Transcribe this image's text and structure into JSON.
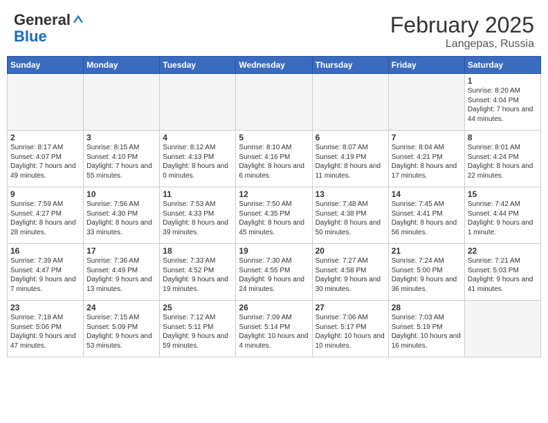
{
  "header": {
    "logo_general": "General",
    "logo_blue": "Blue",
    "month_year": "February 2025",
    "location": "Langepas, Russia"
  },
  "weekdays": [
    "Sunday",
    "Monday",
    "Tuesday",
    "Wednesday",
    "Thursday",
    "Friday",
    "Saturday"
  ],
  "weeks": [
    [
      {
        "day": "",
        "empty": true
      },
      {
        "day": "",
        "empty": true
      },
      {
        "day": "",
        "empty": true
      },
      {
        "day": "",
        "empty": true
      },
      {
        "day": "",
        "empty": true
      },
      {
        "day": "",
        "empty": true
      },
      {
        "day": "1",
        "sunrise": "8:20 AM",
        "sunset": "4:04 PM",
        "daylight": "7 hours and 44 minutes."
      }
    ],
    [
      {
        "day": "2",
        "sunrise": "8:17 AM",
        "sunset": "4:07 PM",
        "daylight": "7 hours and 49 minutes."
      },
      {
        "day": "3",
        "sunrise": "8:15 AM",
        "sunset": "4:10 PM",
        "daylight": "7 hours and 55 minutes."
      },
      {
        "day": "4",
        "sunrise": "8:12 AM",
        "sunset": "4:13 PM",
        "daylight": "8 hours and 0 minutes."
      },
      {
        "day": "5",
        "sunrise": "8:10 AM",
        "sunset": "4:16 PM",
        "daylight": "8 hours and 6 minutes."
      },
      {
        "day": "6",
        "sunrise": "8:07 AM",
        "sunset": "4:19 PM",
        "daylight": "8 hours and 11 minutes."
      },
      {
        "day": "7",
        "sunrise": "8:04 AM",
        "sunset": "4:21 PM",
        "daylight": "8 hours and 17 minutes."
      },
      {
        "day": "8",
        "sunrise": "8:01 AM",
        "sunset": "4:24 PM",
        "daylight": "8 hours and 22 minutes."
      }
    ],
    [
      {
        "day": "9",
        "sunrise": "7:59 AM",
        "sunset": "4:27 PM",
        "daylight": "8 hours and 28 minutes."
      },
      {
        "day": "10",
        "sunrise": "7:56 AM",
        "sunset": "4:30 PM",
        "daylight": "8 hours and 33 minutes."
      },
      {
        "day": "11",
        "sunrise": "7:53 AM",
        "sunset": "4:33 PM",
        "daylight": "8 hours and 39 minutes."
      },
      {
        "day": "12",
        "sunrise": "7:50 AM",
        "sunset": "4:35 PM",
        "daylight": "8 hours and 45 minutes."
      },
      {
        "day": "13",
        "sunrise": "7:48 AM",
        "sunset": "4:38 PM",
        "daylight": "8 hours and 50 minutes."
      },
      {
        "day": "14",
        "sunrise": "7:45 AM",
        "sunset": "4:41 PM",
        "daylight": "8 hours and 56 minutes."
      },
      {
        "day": "15",
        "sunrise": "7:42 AM",
        "sunset": "4:44 PM",
        "daylight": "9 hours and 1 minute."
      }
    ],
    [
      {
        "day": "16",
        "sunrise": "7:39 AM",
        "sunset": "4:47 PM",
        "daylight": "9 hours and 7 minutes."
      },
      {
        "day": "17",
        "sunrise": "7:36 AM",
        "sunset": "4:49 PM",
        "daylight": "9 hours and 13 minutes."
      },
      {
        "day": "18",
        "sunrise": "7:33 AM",
        "sunset": "4:52 PM",
        "daylight": "9 hours and 19 minutes."
      },
      {
        "day": "19",
        "sunrise": "7:30 AM",
        "sunset": "4:55 PM",
        "daylight": "9 hours and 24 minutes."
      },
      {
        "day": "20",
        "sunrise": "7:27 AM",
        "sunset": "4:58 PM",
        "daylight": "9 hours and 30 minutes."
      },
      {
        "day": "21",
        "sunrise": "7:24 AM",
        "sunset": "5:00 PM",
        "daylight": "9 hours and 36 minutes."
      },
      {
        "day": "22",
        "sunrise": "7:21 AM",
        "sunset": "5:03 PM",
        "daylight": "9 hours and 41 minutes."
      }
    ],
    [
      {
        "day": "23",
        "sunrise": "7:18 AM",
        "sunset": "5:06 PM",
        "daylight": "9 hours and 47 minutes."
      },
      {
        "day": "24",
        "sunrise": "7:15 AM",
        "sunset": "5:09 PM",
        "daylight": "9 hours and 53 minutes."
      },
      {
        "day": "25",
        "sunrise": "7:12 AM",
        "sunset": "5:11 PM",
        "daylight": "9 hours and 59 minutes."
      },
      {
        "day": "26",
        "sunrise": "7:09 AM",
        "sunset": "5:14 PM",
        "daylight": "10 hours and 4 minutes."
      },
      {
        "day": "27",
        "sunrise": "7:06 AM",
        "sunset": "5:17 PM",
        "daylight": "10 hours and 10 minutes."
      },
      {
        "day": "28",
        "sunrise": "7:03 AM",
        "sunset": "5:19 PM",
        "daylight": "10 hours and 16 minutes."
      },
      {
        "day": "",
        "empty": true
      }
    ]
  ]
}
